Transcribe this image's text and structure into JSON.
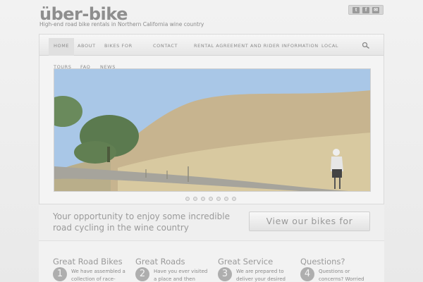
{
  "header": {
    "logo": "über-bike",
    "tagline": "High-end road bike rentals in Northern California wine country"
  },
  "social": {
    "twitter": "t",
    "facebook": "f",
    "email": "✉"
  },
  "nav": {
    "home": "HOME",
    "about": "ABOUT",
    "bikes_for": "BIKES FOR",
    "contact": "CONTACT",
    "rental_agreement": "RENTAL AGREEMENT AND RIDER INFORMATION",
    "local": "LOCAL",
    "tours": "TOURS",
    "faq": "FAQ",
    "news": "NEWS"
  },
  "slider": {
    "slide_count": 7,
    "active_slide": 1
  },
  "promo": {
    "text": "Your opportunity to enjoy some incredible road cycling in the wine country",
    "button": "View our bikes for"
  },
  "features": [
    {
      "title": "Great Road Bikes",
      "number": "1",
      "text": "We have assembled a collection of race-"
    },
    {
      "title": "Great Roads",
      "number": "2",
      "text": "Have you ever visited a place and then wished"
    },
    {
      "title": "Great Service",
      "number": "3",
      "text": "We are prepared to deliver your desired"
    },
    {
      "title": "Questions?",
      "number": "4",
      "text": "Questions or concerns? Worried"
    }
  ],
  "colors": {
    "accent": "#8e8e8e",
    "background": "#ececec"
  }
}
